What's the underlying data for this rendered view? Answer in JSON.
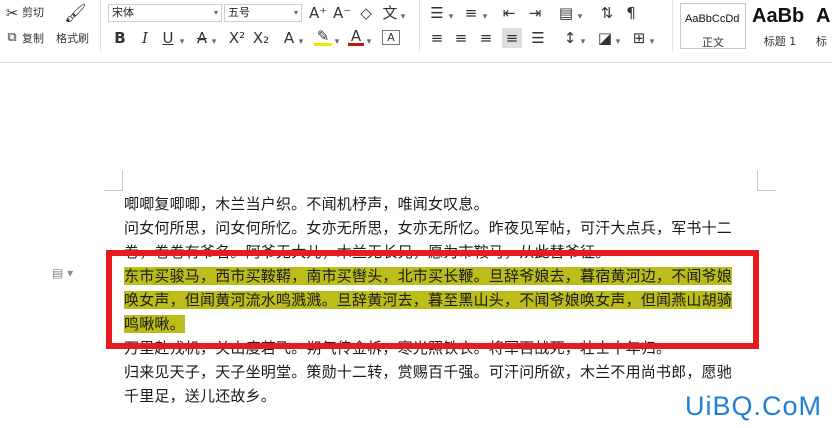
{
  "ribbon": {
    "clipboard": {
      "cut_label": "剪切",
      "copy_label": "复制",
      "format_painter_label": "格式刷"
    },
    "font": {
      "font_name": "宋体",
      "font_size": "五号"
    },
    "styles": [
      {
        "sample": "AaBbCcDd",
        "label": "正文"
      },
      {
        "sample": "AaBb",
        "label": "标题 1"
      },
      {
        "sample": "A",
        "label": "标"
      }
    ]
  },
  "document": {
    "lines": [
      "唧唧复唧唧，木兰当户织。不闻机杼声，唯闻女叹息。",
      "问女何所思，问女何所忆。女亦无所思，女亦无所忆。昨夜见军帖，可汗大点兵，军书十二",
      "卷，卷卷有爷名。阿爷无大儿，木兰无长兄，愿为市鞍马，从此替爷征。"
    ],
    "highlighted_lines": [
      "东市买骏马，西市买鞍鞯，南市买辔头，北市买长鞭。旦辞爷娘去，暮宿黄河边，不闻爷娘",
      "唤女声，但闻黄河流水鸣溅溅。旦辞黄河去，暮至黑山头，不闻爷娘唤女声，但闻燕山胡骑",
      "鸣啾啾。"
    ],
    "after_lines": [
      "万里赴戎机，关山度若飞。朔气传金柝，寒光照铁衣。将军百战死，壮士十年归。",
      "归来见天子，天子坐明堂。策勋十二转，赏赐百千强。可汗问所欲，木兰不用尚书郎，愿驰",
      "千里足，送儿还故乡。"
    ]
  },
  "watermark": "UiBQ.CoM",
  "colors": {
    "highlight": "#bcbd1a",
    "annotation_box": "#e51c23",
    "watermark": "#1f7fd6"
  }
}
